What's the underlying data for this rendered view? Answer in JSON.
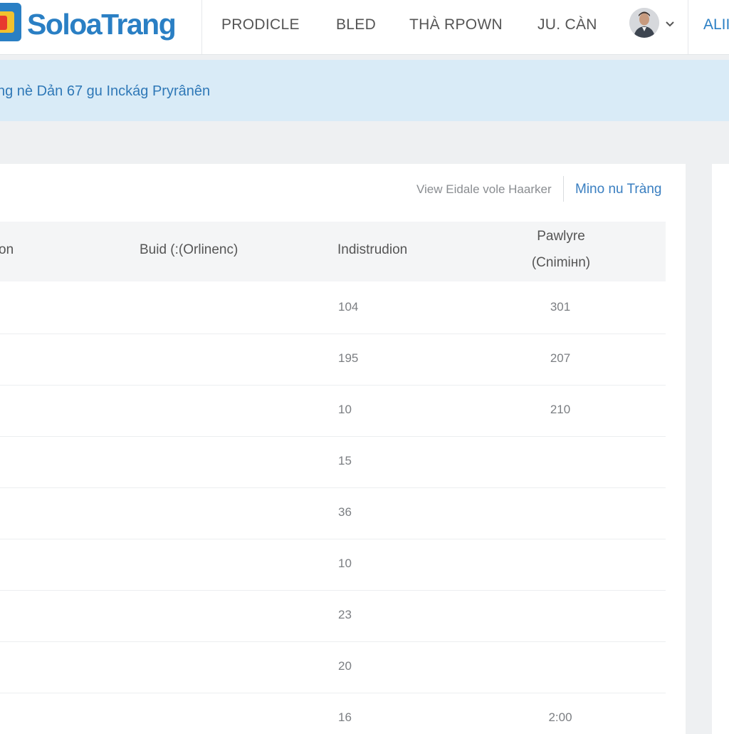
{
  "header": {
    "brand": "SoloaTrang",
    "nav": [
      "PRODICLE",
      "BLED",
      "THÀ RPOWN",
      "JU. CÀN"
    ],
    "nav_cut": "ALII",
    "user_avatar": "avatar-photo",
    "menu_icon": "chevron-down-icon"
  },
  "banner": {
    "text": "ng nè Dản 67 gu Inckág Pryrânên"
  },
  "toolbar": {
    "view_link": "View Eidale vole Haarker",
    "action_link": "Mino nu Tràng"
  },
  "table": {
    "headers": {
      "col1": "on",
      "col2": "Buid (:(Orlinenc)",
      "col3": "Indistrudion",
      "col4_line1": "Pawlyre",
      "col4_line2": "(Cnimінn)"
    },
    "rows": [
      {
        "ind": "104",
        "pay": "301"
      },
      {
        "ind": "195",
        "pay": "207"
      },
      {
        "ind": "10",
        "pay": "210"
      },
      {
        "ind": "15",
        "pay": ""
      },
      {
        "ind": "36",
        "pay": ""
      },
      {
        "ind": "10",
        "pay": ""
      },
      {
        "ind": "23",
        "pay": ""
      },
      {
        "ind": "20",
        "pay": ""
      },
      {
        "ind": "16",
        "pay": "2:00"
      }
    ]
  },
  "colors": {
    "brand_blue": "#2a7fc4",
    "banner_bg": "#d9ebf7",
    "logo_red": "#e8392f",
    "logo_yellow": "#f2c12e",
    "logo_blue": "#2a7fc4"
  }
}
